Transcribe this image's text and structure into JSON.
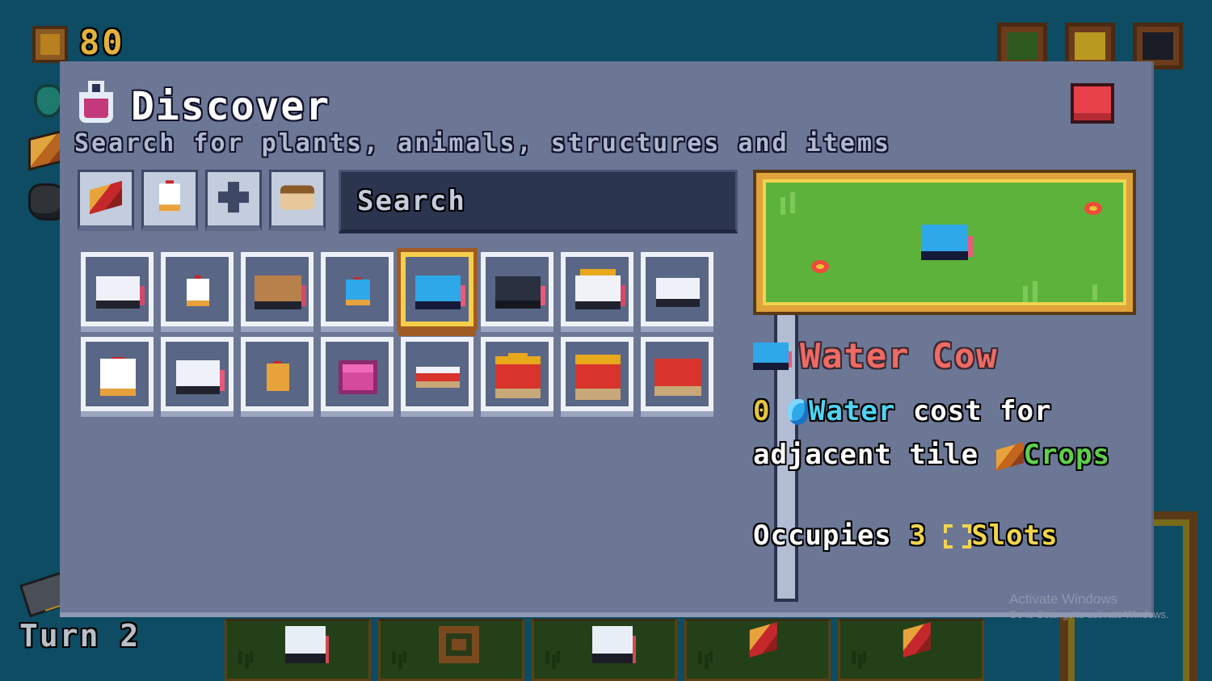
{
  "hud": {
    "resource_count": "80",
    "resource_icon": "crate-icon",
    "turn_label": "Turn 2",
    "side_resources": [
      "water-drop-icon",
      "wheat-crop-icon",
      "coal-icon",
      "tool-icon"
    ],
    "top_right_buttons": [
      "book-green-button",
      "book-gold-button",
      "cow-portrait-button"
    ]
  },
  "panel": {
    "icon": "flask-icon",
    "title": "Discover",
    "subtitle": "Search for plants, animals, structures and items",
    "close_label": "close-button"
  },
  "filters": [
    {
      "name": "filter-crops",
      "icon": "crop-icon"
    },
    {
      "name": "filter-animals",
      "icon": "chicken-icon"
    },
    {
      "name": "filter-structures",
      "icon": "cross-structure-icon"
    },
    {
      "name": "filter-items",
      "icon": "bread-icon"
    }
  ],
  "search": {
    "placeholder": "Search",
    "value": ""
  },
  "grid": {
    "selected_index": 4,
    "items": [
      {
        "name": "cow",
        "icon": "cow-white-icon"
      },
      {
        "name": "chicken",
        "icon": "chicken-small-icon"
      },
      {
        "name": "brown-cow",
        "icon": "cow-brown-icon"
      },
      {
        "name": "water-chicken",
        "icon": "chicken-blue-icon"
      },
      {
        "name": "water-cow",
        "icon": "cow-blue-icon"
      },
      {
        "name": "coal-cow",
        "icon": "cow-dark-icon"
      },
      {
        "name": "gold-cow",
        "icon": "cow-gold-icon"
      },
      {
        "name": "cow-head",
        "icon": "cow-head-icon"
      },
      {
        "name": "rooster",
        "icon": "rooster-icon"
      },
      {
        "name": "spotted-cow",
        "icon": "cow-spotted-icon"
      },
      {
        "name": "chick",
        "icon": "chick-icon"
      },
      {
        "name": "pink-block",
        "icon": "pink-block-icon"
      },
      {
        "name": "red-cart",
        "icon": "cart-small-icon"
      },
      {
        "name": "red-wagon",
        "icon": "wagon-icon"
      },
      {
        "name": "red-wagon-2",
        "icon": "wagon-tall-icon"
      },
      {
        "name": "loaded-wagon",
        "icon": "wagon-loaded-icon"
      }
    ]
  },
  "scrollbar": {
    "name": "grid-scrollbar"
  },
  "preview": {
    "name": "creature-preview",
    "background": "#5cb23a",
    "frame_color": "#f0d44e",
    "creature": "water-cow-sprite",
    "decor": [
      "flower-red",
      "flower-red",
      "grass-tuft",
      "grass-tuft",
      "grass-blade"
    ]
  },
  "detail": {
    "title": "Water Cow",
    "title_color": "#ef6a63",
    "cost_amount": "0",
    "cost_resource": "Water",
    "cost_resource_color": "#4fd4f2",
    "cost_text_1": "cost for",
    "cost_text_2": "adjacent tile",
    "cost_target": "Crops",
    "cost_target_color": "#5fcf4a",
    "slots_label": "Occupies",
    "slots_count": "3",
    "slots_suffix": "Slots",
    "slots_color": "#f0d44e"
  },
  "hand": {
    "cards": [
      {
        "name": "hand-card-cow",
        "icon": "cow-white-icon"
      },
      {
        "name": "hand-card-fence",
        "icon": "fence-icon"
      },
      {
        "name": "hand-card-cow-2",
        "icon": "cow-white-icon"
      },
      {
        "name": "hand-card-crop",
        "icon": "crop-icon"
      },
      {
        "name": "hand-card-crop-2",
        "icon": "crop-icon"
      }
    ]
  },
  "watermark": {
    "line1": "Activate Windows",
    "line2": "Go to Settings to activate Windows."
  },
  "colors": {
    "panel_bg": "#6b7795",
    "world_bg": "#0d4c63",
    "accent_gold": "#f0d44e",
    "close_red": "#e8414a"
  }
}
